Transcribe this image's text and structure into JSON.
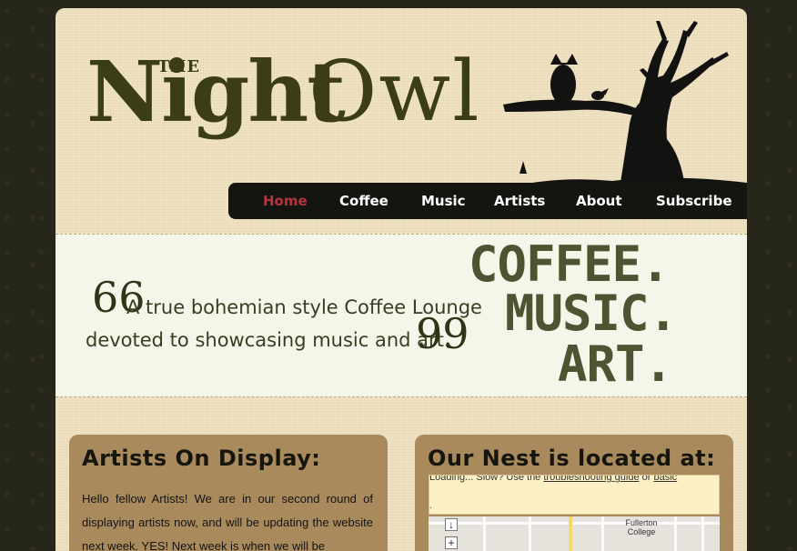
{
  "logo": {
    "the": "THE",
    "night": "Night",
    "owl": "Owl"
  },
  "nav": {
    "items": [
      {
        "label": "Home",
        "active": true
      },
      {
        "label": "Coffee",
        "active": false
      },
      {
        "label": "Music",
        "active": false
      },
      {
        "label": "Artists",
        "active": false
      },
      {
        "label": "About",
        "active": false
      },
      {
        "label": "Subscribe",
        "active": false
      }
    ]
  },
  "banner": {
    "quote_open": "66",
    "quote_close": "99",
    "tagline_line1": "A true bohemian style Coffee Lounge",
    "tagline_line2": "devoted to showcasing music and art.",
    "stamp": [
      "COFFEE.",
      "MUSIC.",
      "ART."
    ]
  },
  "panels": {
    "left": {
      "title": "Artists On Display:",
      "body": "Hello fellow Artists! We are in our second round of displaying artists now, and will be updating the website next week. YES! Next week is when we will be"
    },
    "right": {
      "title": "Our Nest is located at:",
      "loading_text": "Loading... Slow? Use the",
      "loading_link1": "troubleshooting guide",
      "loading_or": "or",
      "loading_link2": "basic",
      "loading_dot": ".",
      "map_label": "Fullerton College"
    }
  },
  "colors": {
    "background": "#27261a",
    "page": "#f0e3c4",
    "nav": "#141410",
    "active_nav": "#b5363a",
    "panel": "#a88a5d",
    "logo": "#3a3d17"
  }
}
